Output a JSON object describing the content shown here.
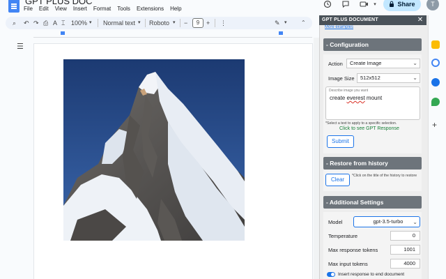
{
  "doc": {
    "title": "GPT PLUS DOC"
  },
  "menu": [
    "File",
    "Edit",
    "View",
    "Insert",
    "Format",
    "Tools",
    "Extensions",
    "Help"
  ],
  "header": {
    "share_label": "Share",
    "avatar_letter": "T"
  },
  "toolbar": {
    "zoom": "100%",
    "style": "Normal text",
    "font": "Roboto",
    "font_size": "9"
  },
  "panel": {
    "title": "GPT PLUS DOCUMENT",
    "close": "✕",
    "more_link": "More examples",
    "configuration": {
      "heading": "- Configuration",
      "action_label": "Action",
      "action_value": "Create Image",
      "size_label": "Image Size",
      "size_value": "512x512",
      "prompt_placeholder": "Describe image you want",
      "prompt_value_pre": "create ",
      "prompt_value_spell": "everest",
      "prompt_value_post": " mount",
      "select_note": "*Select a text to apply to a specific selection.",
      "response_link": "Click to see GPT Response",
      "submit_label": "Submit"
    },
    "history": {
      "heading": "- Restore from history",
      "clear_label": "Clear",
      "note": "*Click on the title of the history to restore"
    },
    "settings": {
      "heading": "- Additional Settings",
      "model_label": "Model",
      "model_value": "gpt-3.5-turbo",
      "temperature_label": "Temperature",
      "temperature_value": "0",
      "max_response_label": "Max response tokens",
      "max_response_value": "1001",
      "max_input_label": "Max input tokens",
      "max_input_value": "4000",
      "insert_label": "Insert response to end document"
    }
  },
  "colors": {
    "accent": "#1a73e8",
    "section_bar": "#6d747b",
    "panel_header": "#4a5259",
    "share_bg": "#c2e7ff",
    "link_green": "#188038"
  }
}
